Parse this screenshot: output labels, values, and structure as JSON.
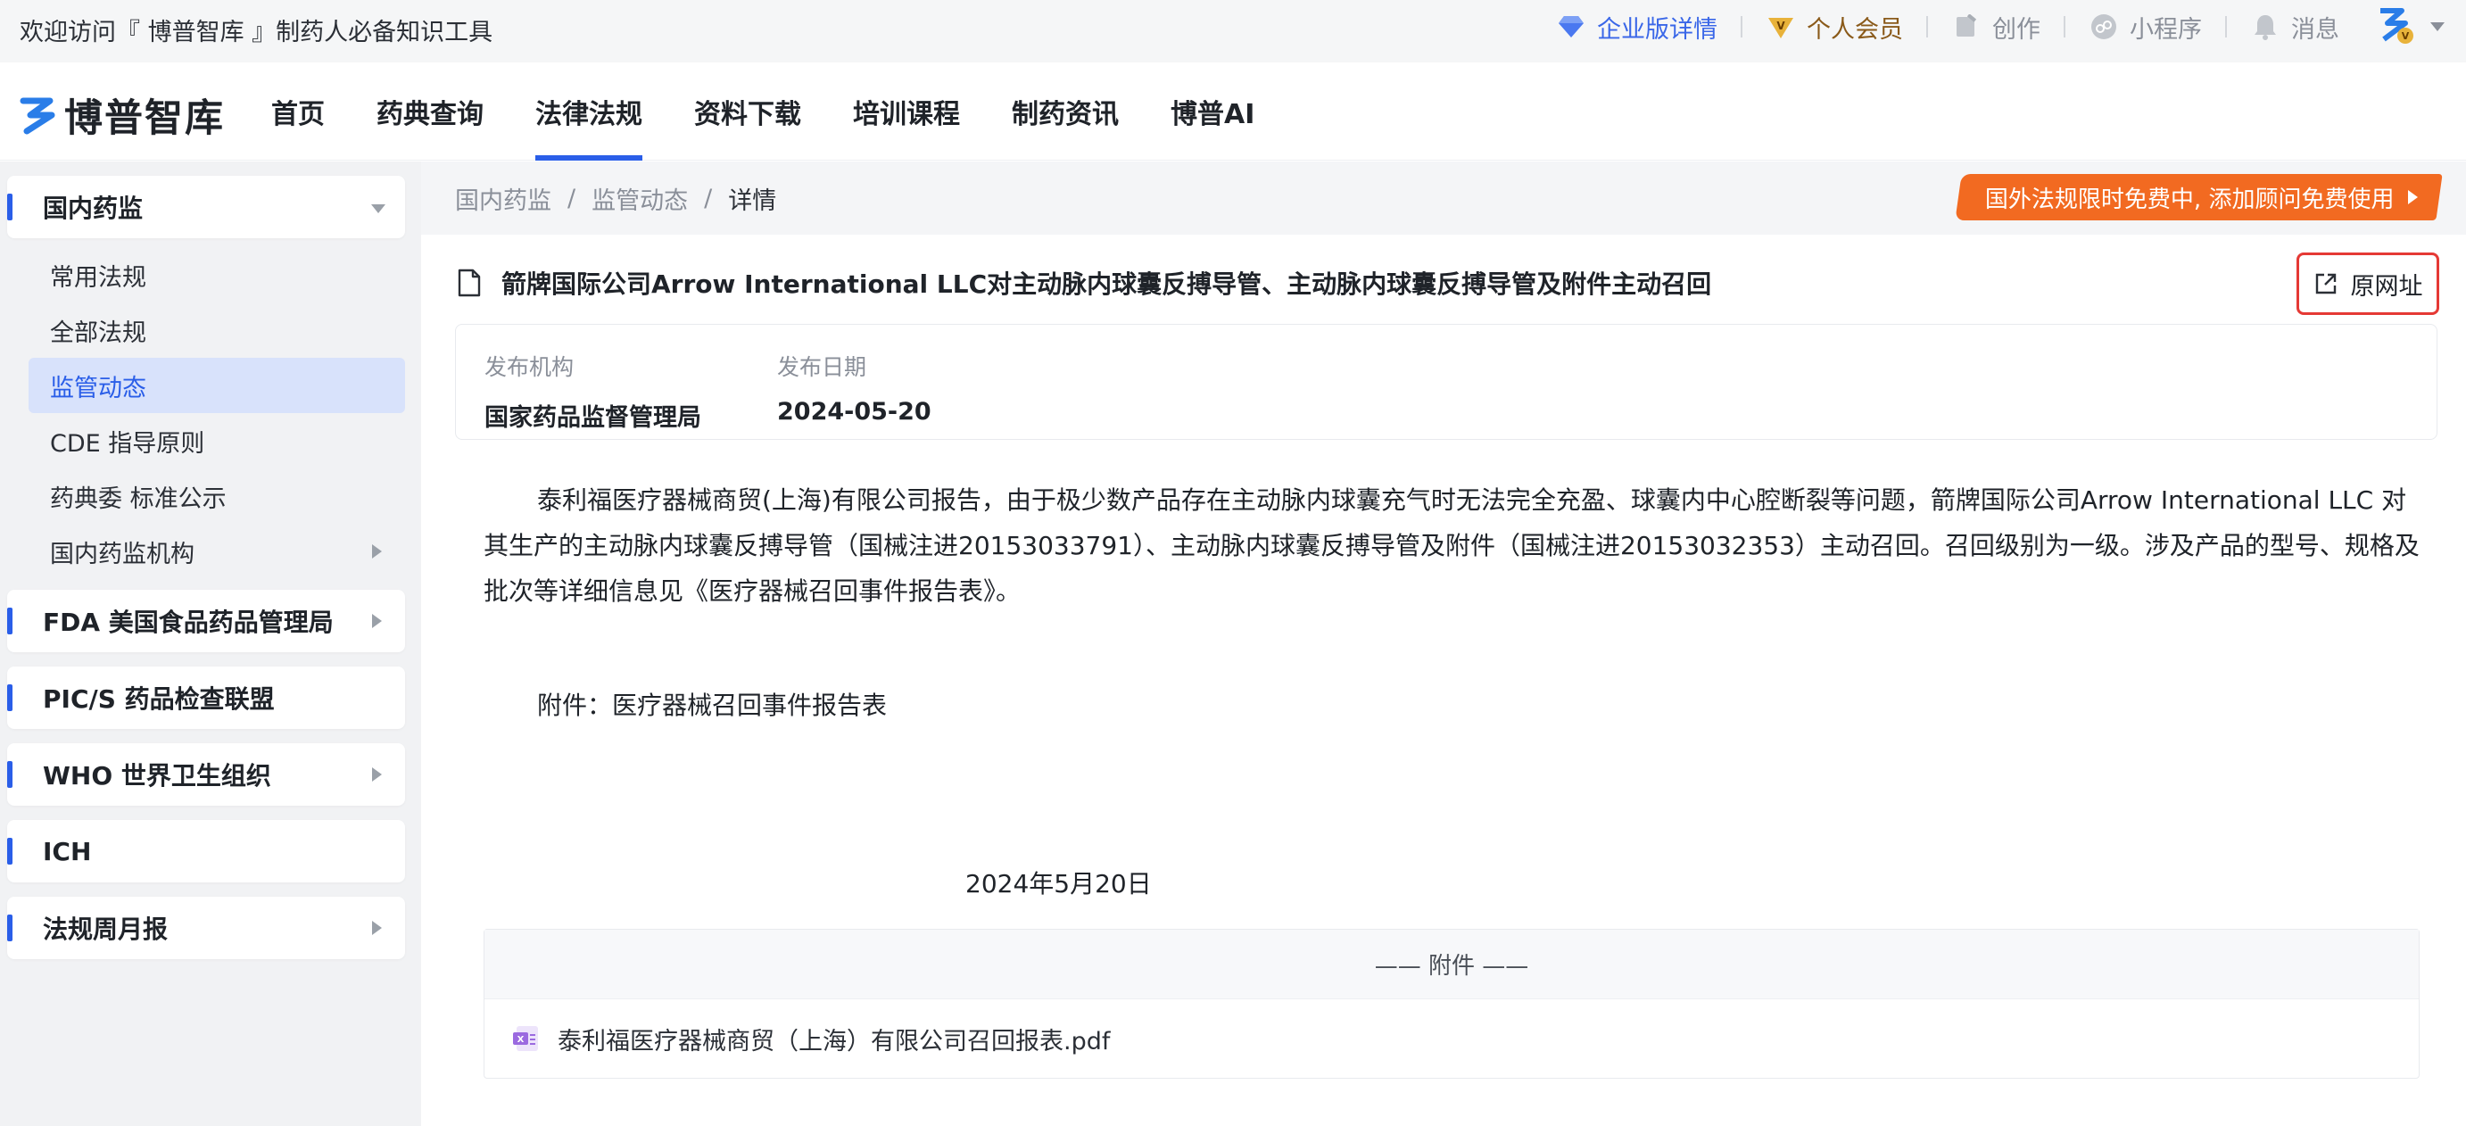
{
  "topbar": {
    "welcome": "欢迎访问『 博普智库 』制药人必备知识工具",
    "links": {
      "enterprise": "企业版详情",
      "vip": "个人会员",
      "create": "创作",
      "miniprogram": "小程序",
      "messages": "消息"
    }
  },
  "header": {
    "logo_text": "博普智库",
    "nav": [
      "首页",
      "药典查询",
      "法律法规",
      "资料下载",
      "培训课程",
      "制药资讯",
      "博普AI"
    ],
    "active_nav": "法律法规"
  },
  "sidebar": {
    "groups": {
      "domestic": "国内药监",
      "fda": "FDA 美国食品药品管理局",
      "pics": "PIC/S 药品检查联盟",
      "who": "WHO 世界卫生组织",
      "ich": "ICH",
      "weekly": "法规周月报"
    },
    "sub_items": [
      "常用法规",
      "全部法规",
      "监管动态",
      "CDE 指导原则",
      "药典委 标准公示",
      "国内药监机构"
    ],
    "active_sub": "监管动态"
  },
  "breadcrumb": {
    "items": [
      "国内药监",
      "监管动态",
      "详情"
    ],
    "separator": "/"
  },
  "promo": {
    "text": "国外法规限时免费中, 添加顾问免费使用"
  },
  "article": {
    "title": "箭牌国际公司Arrow International LLC对主动脉内球囊反搏导管、主动脉内球囊反搏导管及附件主动召回",
    "source_button": "原网址",
    "meta": {
      "org_label": "发布机构",
      "org_value": "国家药品监督管理局",
      "date_label": "发布日期",
      "date_value": "2024-05-20"
    },
    "body": "泰利福医疗器械商贸(上海)有限公司报告，由于极少数产品存在主动脉内球囊充气时无法完全充盈、球囊内中心腔断裂等问题，箭牌国际公司Arrow International LLC 对其生产的主动脉内球囊反搏导管（国械注进20153033791）、主动脉内球囊反搏导管及附件（国械注进20153032353）主动召回。召回级别为一级。涉及产品的型号、规格及批次等详细信息见《医疗器械召回事件报告表》。",
    "attachment_line": "附件：医疗器械召回事件报告表",
    "date_line": "2024年5月20日",
    "attachments_header": "—— 附件 ——",
    "attachment_file": "泰利福医疗器械商贸（上海）有限公司召回报表.pdf"
  },
  "colors": {
    "accent": "#2a5ee8",
    "promo": "#f26a21",
    "highlight_border": "#e53935"
  }
}
